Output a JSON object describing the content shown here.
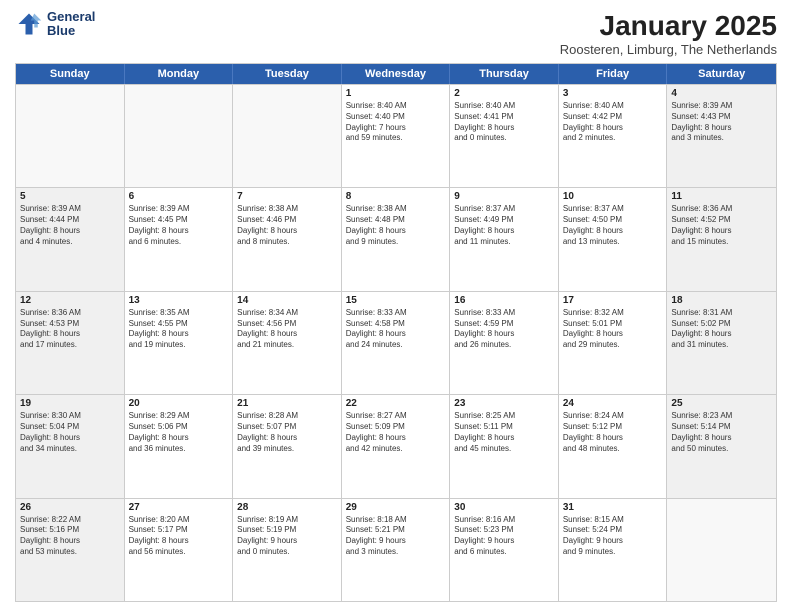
{
  "logo": {
    "line1": "General",
    "line2": "Blue"
  },
  "title": "January 2025",
  "subtitle": "Roosteren, Limburg, The Netherlands",
  "headers": [
    "Sunday",
    "Monday",
    "Tuesday",
    "Wednesday",
    "Thursday",
    "Friday",
    "Saturday"
  ],
  "rows": [
    [
      {
        "day": "",
        "lines": [],
        "empty": true
      },
      {
        "day": "",
        "lines": [],
        "empty": true
      },
      {
        "day": "",
        "lines": [],
        "empty": true
      },
      {
        "day": "1",
        "lines": [
          "Sunrise: 8:40 AM",
          "Sunset: 4:40 PM",
          "Daylight: 7 hours",
          "and 59 minutes."
        ],
        "shaded": false
      },
      {
        "day": "2",
        "lines": [
          "Sunrise: 8:40 AM",
          "Sunset: 4:41 PM",
          "Daylight: 8 hours",
          "and 0 minutes."
        ],
        "shaded": false
      },
      {
        "day": "3",
        "lines": [
          "Sunrise: 8:40 AM",
          "Sunset: 4:42 PM",
          "Daylight: 8 hours",
          "and 2 minutes."
        ],
        "shaded": false
      },
      {
        "day": "4",
        "lines": [
          "Sunrise: 8:39 AM",
          "Sunset: 4:43 PM",
          "Daylight: 8 hours",
          "and 3 minutes."
        ],
        "shaded": true
      }
    ],
    [
      {
        "day": "5",
        "lines": [
          "Sunrise: 8:39 AM",
          "Sunset: 4:44 PM",
          "Daylight: 8 hours",
          "and 4 minutes."
        ],
        "shaded": true
      },
      {
        "day": "6",
        "lines": [
          "Sunrise: 8:39 AM",
          "Sunset: 4:45 PM",
          "Daylight: 8 hours",
          "and 6 minutes."
        ],
        "shaded": false
      },
      {
        "day": "7",
        "lines": [
          "Sunrise: 8:38 AM",
          "Sunset: 4:46 PM",
          "Daylight: 8 hours",
          "and 8 minutes."
        ],
        "shaded": false
      },
      {
        "day": "8",
        "lines": [
          "Sunrise: 8:38 AM",
          "Sunset: 4:48 PM",
          "Daylight: 8 hours",
          "and 9 minutes."
        ],
        "shaded": false
      },
      {
        "day": "9",
        "lines": [
          "Sunrise: 8:37 AM",
          "Sunset: 4:49 PM",
          "Daylight: 8 hours",
          "and 11 minutes."
        ],
        "shaded": false
      },
      {
        "day": "10",
        "lines": [
          "Sunrise: 8:37 AM",
          "Sunset: 4:50 PM",
          "Daylight: 8 hours",
          "and 13 minutes."
        ],
        "shaded": false
      },
      {
        "day": "11",
        "lines": [
          "Sunrise: 8:36 AM",
          "Sunset: 4:52 PM",
          "Daylight: 8 hours",
          "and 15 minutes."
        ],
        "shaded": true
      }
    ],
    [
      {
        "day": "12",
        "lines": [
          "Sunrise: 8:36 AM",
          "Sunset: 4:53 PM",
          "Daylight: 8 hours",
          "and 17 minutes."
        ],
        "shaded": true
      },
      {
        "day": "13",
        "lines": [
          "Sunrise: 8:35 AM",
          "Sunset: 4:55 PM",
          "Daylight: 8 hours",
          "and 19 minutes."
        ],
        "shaded": false
      },
      {
        "day": "14",
        "lines": [
          "Sunrise: 8:34 AM",
          "Sunset: 4:56 PM",
          "Daylight: 8 hours",
          "and 21 minutes."
        ],
        "shaded": false
      },
      {
        "day": "15",
        "lines": [
          "Sunrise: 8:33 AM",
          "Sunset: 4:58 PM",
          "Daylight: 8 hours",
          "and 24 minutes."
        ],
        "shaded": false
      },
      {
        "day": "16",
        "lines": [
          "Sunrise: 8:33 AM",
          "Sunset: 4:59 PM",
          "Daylight: 8 hours",
          "and 26 minutes."
        ],
        "shaded": false
      },
      {
        "day": "17",
        "lines": [
          "Sunrise: 8:32 AM",
          "Sunset: 5:01 PM",
          "Daylight: 8 hours",
          "and 29 minutes."
        ],
        "shaded": false
      },
      {
        "day": "18",
        "lines": [
          "Sunrise: 8:31 AM",
          "Sunset: 5:02 PM",
          "Daylight: 8 hours",
          "and 31 minutes."
        ],
        "shaded": true
      }
    ],
    [
      {
        "day": "19",
        "lines": [
          "Sunrise: 8:30 AM",
          "Sunset: 5:04 PM",
          "Daylight: 8 hours",
          "and 34 minutes."
        ],
        "shaded": true
      },
      {
        "day": "20",
        "lines": [
          "Sunrise: 8:29 AM",
          "Sunset: 5:06 PM",
          "Daylight: 8 hours",
          "and 36 minutes."
        ],
        "shaded": false
      },
      {
        "day": "21",
        "lines": [
          "Sunrise: 8:28 AM",
          "Sunset: 5:07 PM",
          "Daylight: 8 hours",
          "and 39 minutes."
        ],
        "shaded": false
      },
      {
        "day": "22",
        "lines": [
          "Sunrise: 8:27 AM",
          "Sunset: 5:09 PM",
          "Daylight: 8 hours",
          "and 42 minutes."
        ],
        "shaded": false
      },
      {
        "day": "23",
        "lines": [
          "Sunrise: 8:25 AM",
          "Sunset: 5:11 PM",
          "Daylight: 8 hours",
          "and 45 minutes."
        ],
        "shaded": false
      },
      {
        "day": "24",
        "lines": [
          "Sunrise: 8:24 AM",
          "Sunset: 5:12 PM",
          "Daylight: 8 hours",
          "and 48 minutes."
        ],
        "shaded": false
      },
      {
        "day": "25",
        "lines": [
          "Sunrise: 8:23 AM",
          "Sunset: 5:14 PM",
          "Daylight: 8 hours",
          "and 50 minutes."
        ],
        "shaded": true
      }
    ],
    [
      {
        "day": "26",
        "lines": [
          "Sunrise: 8:22 AM",
          "Sunset: 5:16 PM",
          "Daylight: 8 hours",
          "and 53 minutes."
        ],
        "shaded": true
      },
      {
        "day": "27",
        "lines": [
          "Sunrise: 8:20 AM",
          "Sunset: 5:17 PM",
          "Daylight: 8 hours",
          "and 56 minutes."
        ],
        "shaded": false
      },
      {
        "day": "28",
        "lines": [
          "Sunrise: 8:19 AM",
          "Sunset: 5:19 PM",
          "Daylight: 9 hours",
          "and 0 minutes."
        ],
        "shaded": false
      },
      {
        "day": "29",
        "lines": [
          "Sunrise: 8:18 AM",
          "Sunset: 5:21 PM",
          "Daylight: 9 hours",
          "and 3 minutes."
        ],
        "shaded": false
      },
      {
        "day": "30",
        "lines": [
          "Sunrise: 8:16 AM",
          "Sunset: 5:23 PM",
          "Daylight: 9 hours",
          "and 6 minutes."
        ],
        "shaded": false
      },
      {
        "day": "31",
        "lines": [
          "Sunrise: 8:15 AM",
          "Sunset: 5:24 PM",
          "Daylight: 9 hours",
          "and 9 minutes."
        ],
        "shaded": false
      },
      {
        "day": "",
        "lines": [],
        "empty": true
      }
    ]
  ]
}
